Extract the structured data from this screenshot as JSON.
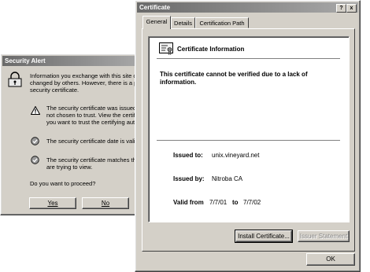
{
  "security_alert": {
    "title": "Security Alert",
    "info_line1": "Information you exchange with this site c",
    "info_line2": "changed by others. However, there is a p",
    "info_line3": "security certificate.",
    "warning1_line1": "The security certificate was issued",
    "warning1_line2": "not chosen to trust. View the certifi",
    "warning1_line3": "you want to trust the certifying auth",
    "ok2_line1": "The security certificate date is valid",
    "ok3_line1": "The security certificate matches the",
    "ok3_line2": "are trying to view.",
    "question": "Do you want to proceed?",
    "yes_label": "Yes",
    "no_label": "No"
  },
  "certificate": {
    "title": "Certificate",
    "help_label": "?",
    "close_label": "x",
    "tabs": [
      {
        "label": "General",
        "active": true
      },
      {
        "label": "Details",
        "active": false
      },
      {
        "label": "Certification Path",
        "active": false
      }
    ],
    "info_heading": "Certificate Information",
    "warning_line1": "This certificate cannot be verified due to a lack of",
    "warning_line2": "information.",
    "issued_to_label": "Issued to:",
    "issued_to_value": "unix.vineyard.net",
    "issued_by_label": "Issued by:",
    "issued_by_value": "Nitroba CA",
    "valid_from_label": "Valid from",
    "valid_from_value": "7/7/01",
    "valid_to_label": "to",
    "valid_to_value": "7/7/02",
    "install_label": "Install Certificate...",
    "issuer_statement_label": "Issuer Statement",
    "ok_label": "OK"
  },
  "colors": {
    "titlebar_start": "#6a6a6a",
    "titlebar_end": "#a9a9a9",
    "dialog_face": "#d4d0c8"
  }
}
